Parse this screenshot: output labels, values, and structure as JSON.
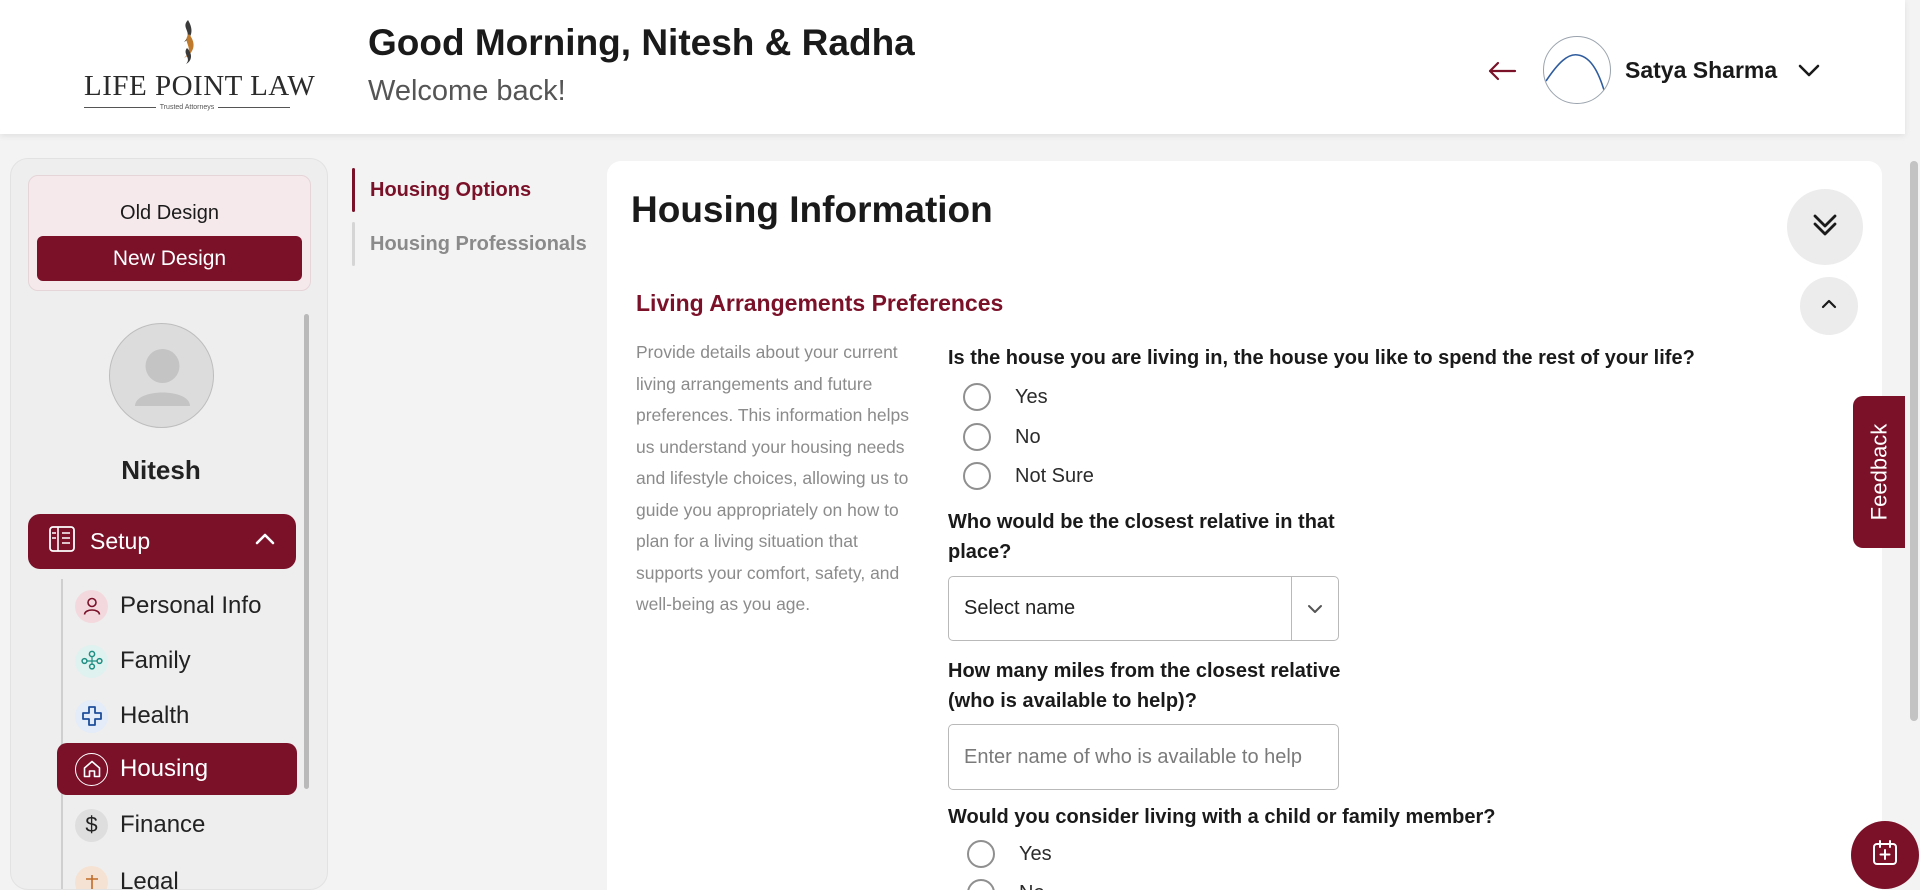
{
  "brand": {
    "logo_text": "LIFE POINT LAW",
    "logo_tagline": "Trusted Attorneys"
  },
  "header": {
    "greeting": "Good Morning, Nitesh & Radha",
    "welcome": "Welcome back!",
    "user_name": "Satya Sharma"
  },
  "sidebar": {
    "old_design_label": "Old Design",
    "new_design_label": "New Design",
    "profile_name": "Nitesh",
    "setup_label": "Setup",
    "items": [
      {
        "label": "Personal Info",
        "icon": "person-icon"
      },
      {
        "label": "Family",
        "icon": "family-icon"
      },
      {
        "label": "Health",
        "icon": "health-cross-icon"
      },
      {
        "label": "Housing",
        "icon": "house-icon",
        "active": true
      },
      {
        "label": "Finance",
        "icon": "dollar-icon"
      },
      {
        "label": "Legal",
        "icon": "legal-icon"
      }
    ]
  },
  "subnav": {
    "items": [
      {
        "label": "Housing Options",
        "active": true
      },
      {
        "label": "Housing Professionals",
        "active": false
      }
    ]
  },
  "main": {
    "title": "Housing Information",
    "section": {
      "title": "Living Arrangements Preferences",
      "description": "Provide details about your current living arrangements and future preferences. This information helps us understand your housing needs and lifestyle choices, allowing us to guide you appropriately on how to plan for a living situation that supports your comfort, safety, and well-being as you age."
    },
    "questions": {
      "q1": {
        "label": "Is the house you are living in, the house you like to spend the rest of your life?",
        "options": [
          "Yes",
          "No",
          "Not Sure"
        ]
      },
      "q2": {
        "label": "Who would be the closest relative in that place?",
        "select_value": "Select name"
      },
      "q3": {
        "label": "How many miles from the closest relative (who is available to help)?",
        "placeholder": "Enter name of who is available to help"
      },
      "q4": {
        "label": "Would you consider living with a child or family member?",
        "options": [
          "Yes",
          "No"
        ]
      }
    }
  },
  "feedback_label": "Feedback",
  "colors": {
    "brand": "#7a1129",
    "background": "#f3f3f3"
  }
}
